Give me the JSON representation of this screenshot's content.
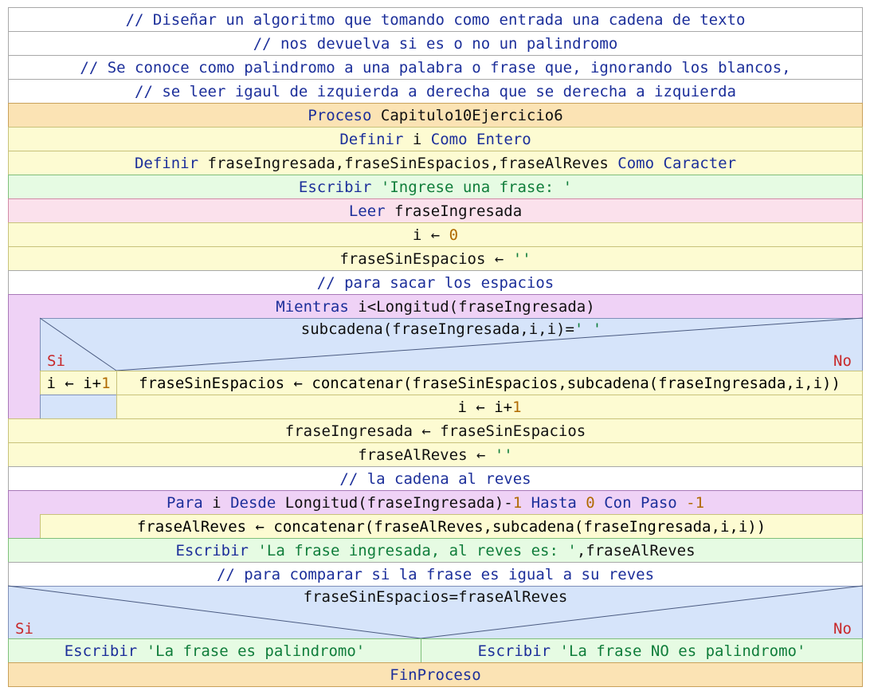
{
  "comments": {
    "c1": "// Diseñar un algoritmo que tomando como entrada una cadena de texto",
    "c2": "// nos devuelva si es o no un palindromo",
    "c3": "// Se conoce como palindromo a una palabra o frase que, ignorando los blancos,",
    "c4": "// se leer igaul de izquierda a derecha que se derecha a izquierda",
    "c5": "// para sacar los espacios",
    "c6": "// la cadena al reves",
    "c7": "// para comparar si la frase es igual a su reves"
  },
  "keywords": {
    "proceso": "Proceso",
    "definir": "Definir",
    "como": "Como",
    "entero": "Entero",
    "caracter": "Caracter",
    "escribir": "Escribir",
    "leer": "Leer",
    "mientras": "Mientras",
    "para": "Para",
    "desde": "Desde",
    "hasta": "Hasta",
    "con_paso": "Con Paso",
    "fin_proceso": "FinProceso"
  },
  "program": {
    "name": "Capitulo10Ejercicio6",
    "def1_vars": "i",
    "def2_vars": "fraseIngresada,fraseSinEspacios,fraseAlReves",
    "write1_str": "'Ingrese una frase: '",
    "read_var": "fraseIngresada",
    "assign_i_lhs": "i",
    "arrow": "←",
    "assign_i_val": "0",
    "assign_fse_lhs": "fraseSinEspacios",
    "empty_str": "''",
    "while_cond": "i<Longitud(fraseIngresada)",
    "if1_cond_a": "subcadena(fraseIngresada,i,i)=",
    "if1_cond_b": "' '",
    "yes": "Si",
    "no": "No",
    "if1_yes_a": "i ",
    "if1_yes_b": " i+",
    "one": "1",
    "if1_no": "fraseSinEspacios ← concatenar(fraseSinEspacios,subcadena(fraseIngresada,i,i))",
    "inc_a": "i ← i+",
    "assign_fi": "fraseIngresada ← fraseSinEspacios",
    "assign_far_lhs": "fraseAlReves ",
    "for_var": "i",
    "for_from": "Longitud(fraseIngresada)-",
    "for_to": "0",
    "for_step": "-1",
    "for_body": "fraseAlReves ← concatenar(fraseAlReves,subcadena(fraseIngresada,i,i))",
    "write2_str": "'La frase ingresada, al reves es: '",
    "write2_var": ",fraseAlReves",
    "if2_cond": "fraseSinEspacios=fraseAlReves",
    "yes_str": "'La frase es palindromo'",
    "no_str": "'La frase NO es palindromo'"
  }
}
